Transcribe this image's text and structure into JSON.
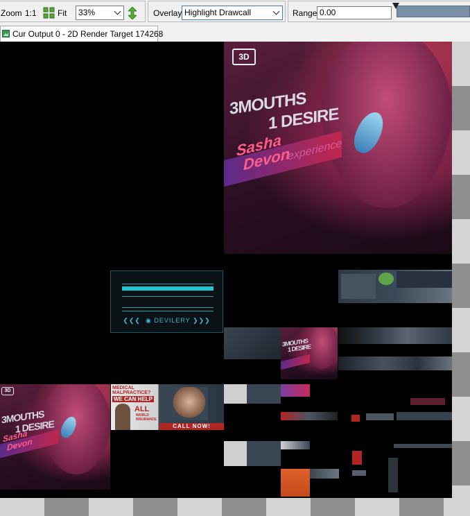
{
  "toolbar": {
    "zoom_label": "Zoom",
    "zoom_1to1": "1:1",
    "fit_label": "Fit",
    "zoom_value": "33%",
    "overlay_label": "Overlay",
    "overlay_value": "Highlight Drawcall",
    "range_label": "Range",
    "range_value": "0.00"
  },
  "tabs": [
    {
      "label": "Cur Output 0 - 2D Render Target 174268"
    }
  ],
  "poster": {
    "logo": "3D",
    "title_line1": "3MOUTHS",
    "title_line2": "1 DESIRE",
    "name_line1": "Sasha",
    "name_line2": "Devon",
    "tagline": "experience"
  },
  "ad": {
    "line1": "MEDICAL",
    "line2": "MALPRACTICE?",
    "headline": "WE CAN HELP",
    "brand": "ALL",
    "brand_sub": "WORLD",
    "brand_sub2": "INSURANCE",
    "cta": "CALL NOW!"
  },
  "dialog": {
    "cta": "DEVILERY"
  },
  "thumb_poster": {
    "title_line1": "3MOUTHS",
    "title_line2": "1 DESIRE"
  },
  "colors": {
    "accent": "#3c7fb1",
    "viewport_light": "#d4d4d4",
    "viewport_dark": "#8f8f8f"
  }
}
